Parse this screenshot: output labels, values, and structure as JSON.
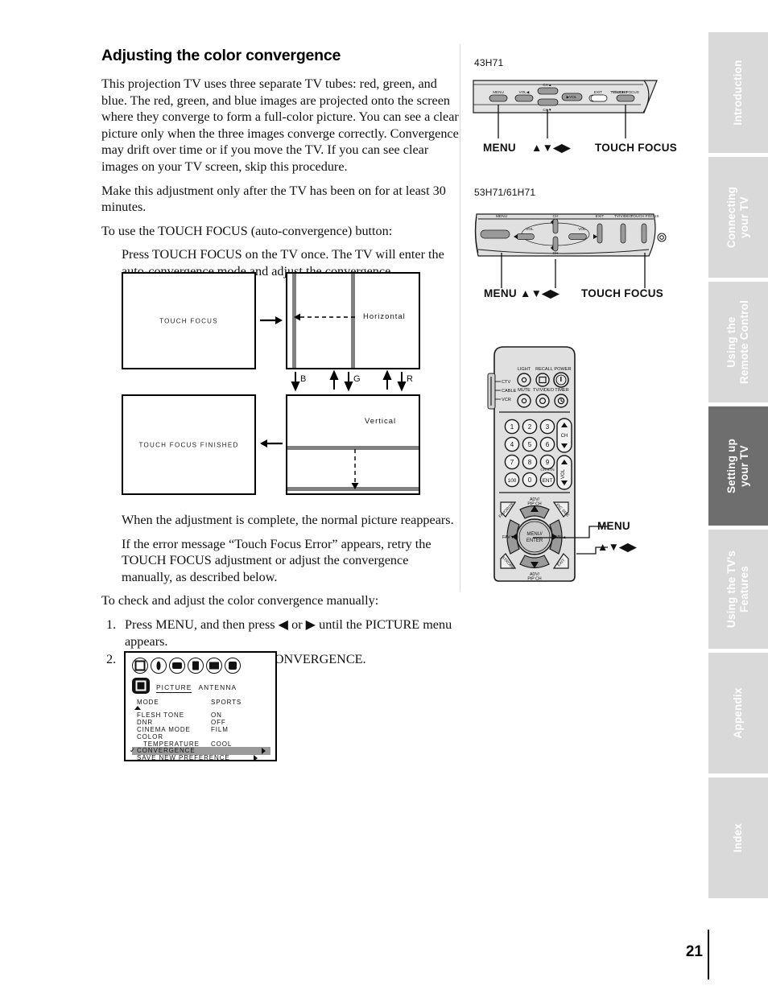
{
  "page": {
    "number": "21"
  },
  "heading": "Adjusting the color convergence",
  "paragraphs": {
    "intro": "This projection TV uses three separate TV tubes: red, green, and blue. The red, green, and blue images are projected onto the screen where they converge to form a full-color picture. You can see a clear picture only when the three images converge correctly. Convergence may drift over time or if you move the TV. If you can see clear images on your TV screen, skip this procedure.",
    "warmup": "Make this adjustment only after the TV has been on for at least 30 minutes.",
    "touch_focus_lead": "To use the TOUCH FOCUS (auto-convergence) button:",
    "touch_focus_step": "Press TOUCH FOCUS on the TV once. The TV will enter the auto-convergence mode and adjust the convergence automatically.",
    "complete": "When the adjustment is complete, the normal picture reappears.",
    "error": "If the error message “Touch Focus Error” appears, retry the TOUCH FOCUS adjustment or adjust the convergence manually, as described below.",
    "manual_lead": "To check and adjust the color convergence manually:"
  },
  "steps": [
    {
      "num": "1.",
      "text": "Press MENU, and then press ◀ or ▶ until the PICTURE menu appears."
    },
    {
      "num": "2.",
      "text": "Press ▲ or ▼ to highlight CONVERGENCE."
    }
  ],
  "flow_diagram": {
    "screen1_caption": "TOUCH FOCUS",
    "screen2_caption": "Horizontal",
    "screen3_caption": "TOUCH FOCUS FINISHED",
    "screen4_caption": "Vertical",
    "color_labels": [
      "B",
      "G",
      "R"
    ]
  },
  "osd_menu": {
    "tab_active": "PICTURE",
    "tab_other": "ANTENNA",
    "rows": [
      {
        "key": "MODE",
        "value": "SPORTS"
      },
      {
        "key": "FLESH TONE",
        "value": "ON"
      },
      {
        "key": "DNR",
        "value": "OFF"
      },
      {
        "key": "CINEMA MODE",
        "value": "FILM"
      },
      {
        "key": "COLOR",
        "value": ""
      },
      {
        "key": "TEMPERATURE",
        "value": "COOL"
      },
      {
        "key": "CONVERGENCE",
        "value": ""
      },
      {
        "key": "SAVE NEW PREFERENCE",
        "value": ""
      }
    ],
    "highlighted_row": "CONVERGENCE"
  },
  "figures": {
    "panel_a": {
      "model": "43H71",
      "buttons": [
        "MENU",
        "VOL◀",
        "CH▲",
        "▶VOL",
        "CH▼",
        "EXIT",
        "TV/VIDEO",
        "TOUCH FOCUS"
      ],
      "callout_left": "MENU",
      "callout_mid": "▲▼◀▶",
      "callout_right": "TOUCH FOCUS"
    },
    "panel_b": {
      "model": "53H71/61H71",
      "buttons": [
        "MENU",
        "VOL",
        "CH",
        "VOL",
        "CH",
        "EXIT",
        "TV/VIDEO",
        "TOUCH FOCUS"
      ],
      "callout_left": "MENU ▲▼◀▶",
      "callout_right": "TOUCH FOCUS"
    },
    "remote": {
      "mode_switch": [
        "CTV",
        "CABLE",
        "VCR"
      ],
      "top_buttons": [
        "LIGHT",
        "RECALL",
        "POWER",
        "MUTE",
        "TV/VIDEO",
        "TIMER"
      ],
      "keypad": [
        "1",
        "2",
        "3",
        "4",
        "5",
        "6",
        "7",
        "8",
        "9",
        "100",
        "0",
        "ENT"
      ],
      "ent_label": "CH RTN",
      "ch_label": "CH",
      "vol_label": "VOL",
      "center_label": "MENU/ENTER",
      "corner_buttons": [
        "FAVORITE",
        "PIC SIZE",
        "STROBE",
        "EXIT"
      ],
      "pad_labels": [
        "ADV/ PIP CH",
        "ADV/ PIP CH",
        "FAV▼",
        "FAV▲"
      ],
      "callout_menu": "MENU",
      "callout_arrows": "▲▼◀▶"
    }
  },
  "side_tabs": [
    {
      "label": [
        "Introduction"
      ],
      "active": false
    },
    {
      "label": [
        "Connecting",
        "your TV"
      ],
      "active": false
    },
    {
      "label": [
        "Using the",
        "Remote Control"
      ],
      "active": false
    },
    {
      "label": [
        "Setting up",
        "your TV"
      ],
      "active": true
    },
    {
      "label": [
        "Using the TV's",
        "Features"
      ],
      "active": false
    },
    {
      "label": [
        "Appendix"
      ],
      "active": false
    },
    {
      "label": [
        "Index"
      ],
      "active": false
    }
  ],
  "colors": {
    "tab_inactive": "#d9d9d9",
    "tab_active": "#6e6e6e",
    "bar_gray": "#808080",
    "highlight_gray": "#9a9a9a"
  }
}
